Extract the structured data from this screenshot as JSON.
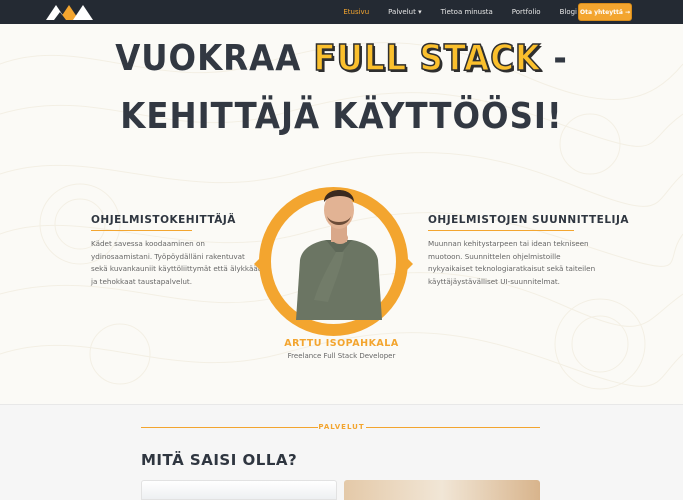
{
  "nav": {
    "items": [
      {
        "label": "Etusivu",
        "active": true
      },
      {
        "label": "Palvelut ▾",
        "active": false
      },
      {
        "label": "Tietoa minusta",
        "active": false
      },
      {
        "label": "Portfolio",
        "active": false
      },
      {
        "label": "Blogi",
        "active": false
      }
    ],
    "cta_label": "Ota yhteyttä →"
  },
  "hero": {
    "line1_prefix": "VUOKRAA",
    "line1_accent": "FULL STACK",
    "line1_suffix": "-",
    "line2": "KEHITTÄJÄ KÄYTTÖÖSI!"
  },
  "left_col": {
    "title": "OHJELMISTOKEHITTÄJÄ",
    "text": "Kädet savessa koodaaminen on ydinosaamistani. Työpöydälläni rakentuvat sekä kuvankauniit käyttöliittymät että älykkäät ja tehokkaat taustapalvelut."
  },
  "right_col": {
    "title": "OHJELMISTOJEN SUUNNITTELIJA",
    "text": "Muunnan kehitystarpeen tai idean tekniseen muotoon. Suunnittelen ohjelmistoille nykyaikaiset teknologiaratkaisut sekä taiteilen käyttäjäystävälliset UI-suunnitelmat."
  },
  "profile": {
    "name": "ARTTU ISOPAHKALA",
    "role": "Freelance Full Stack Developer"
  },
  "services": {
    "label": "PALVELUT",
    "title": "MITÄ SAISI OLLA?"
  },
  "colors": {
    "accent": "#f3a52f",
    "dark": "#242a33"
  }
}
